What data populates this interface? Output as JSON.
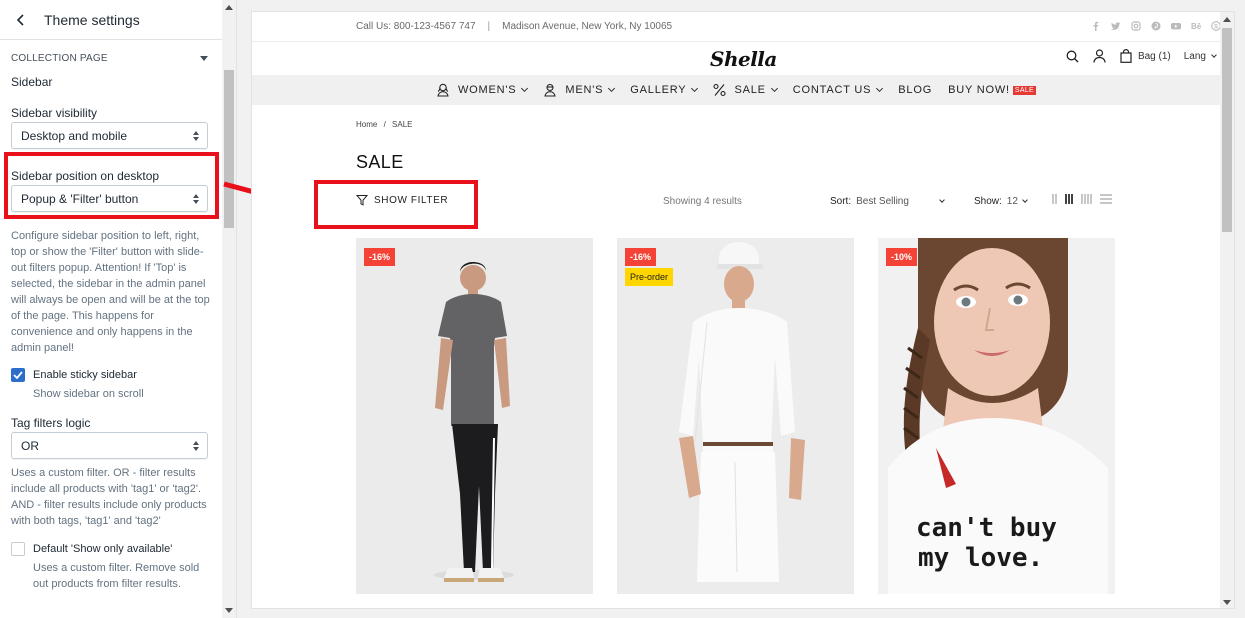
{
  "panel": {
    "title": "Theme settings",
    "section": "COLLECTION PAGE",
    "subheading": "Sidebar",
    "visibility": {
      "label": "Sidebar visibility",
      "value": "Desktop and mobile"
    },
    "position": {
      "label": "Sidebar position on desktop",
      "value": "Popup & 'Filter' button",
      "help": "Configure sidebar position to left, right, top or show the 'Filter' button with slide-out filters popup. Attention! If 'Top' is selected, the sidebar in the admin panel will always be open and will be at the top of the page. This happens for convenience and only happens in the admin panel!"
    },
    "sticky": {
      "label": "Enable sticky sidebar",
      "sub": "Show sidebar on scroll",
      "checked": true
    },
    "tag_logic": {
      "label": "Tag filters logic",
      "value": "OR",
      "help": "Uses a custom filter. OR - filter results include all products with 'tag1' or 'tag2'. AND - filter results include only products with both tags, 'tag1' and 'tag2'"
    },
    "available": {
      "label": "Default 'Show only available'",
      "sub": "Uses a custom filter. Remove sold out products from filter results.",
      "checked": false
    }
  },
  "site": {
    "contact": "Call Us: 800-123-4567 747",
    "address": "Madison Avenue, New York, Ny 10065",
    "sep": "|",
    "socials": [
      "facebook-icon",
      "twitter-icon",
      "instagram-icon",
      "pinterest-icon",
      "youtube-icon",
      "behance-icon",
      "skype-icon"
    ],
    "logo": "Shella",
    "bag": "Bag (1)",
    "lang": "Lang",
    "nav": [
      {
        "label": "WOMEN'S"
      },
      {
        "label": "MEN'S"
      },
      {
        "label": "GALLERY"
      },
      {
        "label": "SALE"
      },
      {
        "label": "CONTACT US"
      },
      {
        "label": "BLOG"
      },
      {
        "label": "BUY NOW!"
      }
    ],
    "nav_sale_tag": "SALE",
    "breadcrumb": {
      "home": "Home",
      "sep": "/",
      "current": "SALE"
    },
    "page_title": "SALE",
    "filter_button": "SHOW FILTER",
    "results": "Showing 4 results",
    "sort_label": "Sort:",
    "sort_value": "Best Selling",
    "show_label": "Show:",
    "show_value": "12",
    "products": [
      {
        "discount": "-16%"
      },
      {
        "discount": "-16%",
        "tag": "Pre-order"
      },
      {
        "discount": "-10%",
        "print": "can't buy my love."
      }
    ]
  },
  "colors": {
    "highlight": "#e8101b",
    "accent": "#2c6ecb",
    "badge": "#f44336",
    "preorder": "#ffd600"
  }
}
